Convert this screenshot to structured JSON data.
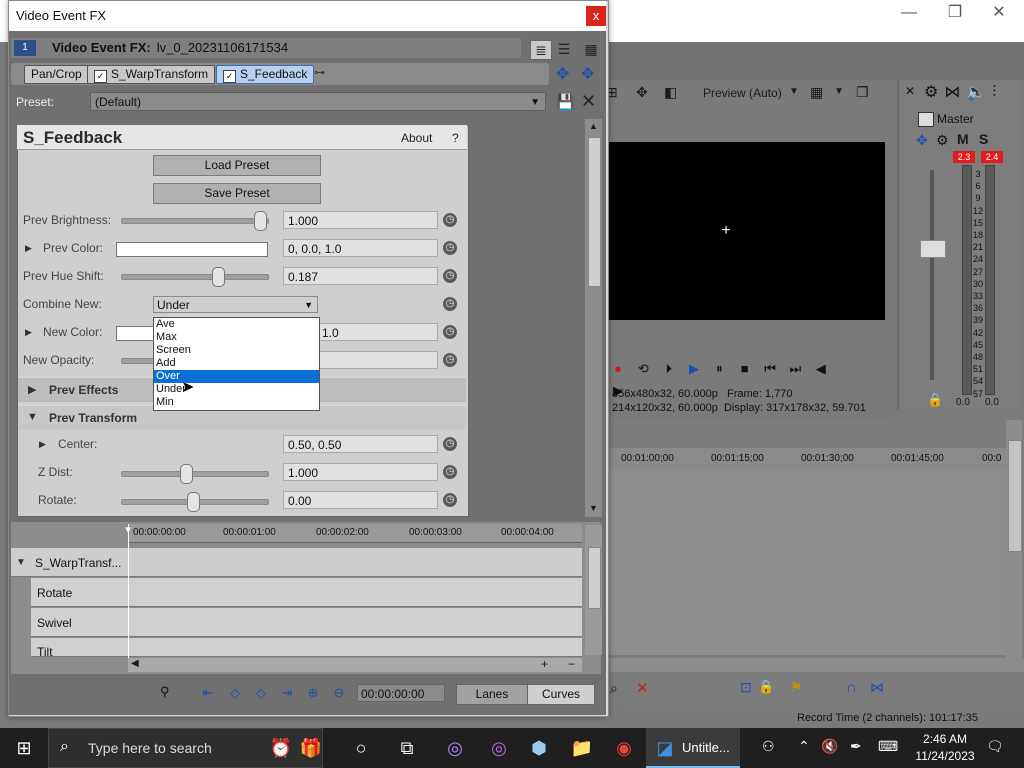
{
  "window": {
    "title": "Video Event FX",
    "close": "x"
  },
  "header": {
    "chain_index": "1",
    "event_label": "Video Event FX:",
    "event_name": "lv_0_20231106171534"
  },
  "fx_chain": [
    {
      "label": "Pan/Crop"
    },
    {
      "label": "S_WarpTransform"
    },
    {
      "label": "S_Feedback"
    }
  ],
  "preset": {
    "label": "Preset:",
    "value": "(Default)"
  },
  "plugin": {
    "name": "S_Feedback",
    "about": "About",
    "help": "?",
    "load_preset": "Load Preset",
    "save_preset": "Save Preset",
    "params": {
      "prev_brightness": {
        "label": "Prev Brightness:",
        "value": "1.000",
        "level": 1.0
      },
      "prev_color": {
        "label": "Prev Color:",
        "value": "0, 0.0, 1.0"
      },
      "prev_hue_shift": {
        "label": "Prev Hue Shift:",
        "value": "0.187",
        "level": 0.69
      },
      "combine_new": {
        "label": "Combine New:",
        "value": "Under"
      },
      "new_color": {
        "label": "New Color:",
        "value": "1.0"
      },
      "new_opacity": {
        "label": "New Opacity:"
      },
      "prev_effects": {
        "label": "Prev Effects"
      },
      "prev_transform": {
        "label": "Prev Transform"
      },
      "center": {
        "label": "Center:",
        "value": "0.50, 0.50"
      },
      "z_dist": {
        "label": "Z Dist:",
        "value": "1.000",
        "level": 0.45
      },
      "rotate": {
        "label": "Rotate:",
        "value": "0.00",
        "level": 0.5
      }
    },
    "combine_options": [
      "Ave",
      "Max",
      "Screen",
      "Add",
      "Over",
      "Under",
      "Min"
    ],
    "combine_highlight": "Over"
  },
  "keyframes": {
    "ruler": [
      "00:00:00:00",
      "00:00:01:00",
      "00:00:02:00",
      "00:00:03:00",
      "00:00:04:00"
    ],
    "track": "S_WarpTransf...",
    "lanes": [
      "Rotate",
      "Swivel",
      "Tilt"
    ],
    "time": "00:00:00:00",
    "lanes_btn": "Lanes",
    "curves_btn": "Curves"
  },
  "preview": {
    "quality": "Preview (Auto)",
    "info_line1_left": "856x480x32, 60.000p",
    "info_line1_right_label": "Frame:",
    "info_line1_right_value": "1,770",
    "info_line2_left": "214x120x32, 60.000p",
    "info_line2_right_label": "Display:",
    "info_line2_right_value": "317x178x32, 59.701"
  },
  "master": {
    "title": "Master",
    "m": "M",
    "s": "S",
    "peak_left": "2.3",
    "peak_right": "2.4",
    "scale": [
      "3",
      "6",
      "9",
      "12",
      "15",
      "18",
      "21",
      "24",
      "27",
      "30",
      "33",
      "36",
      "39",
      "42",
      "45",
      "48",
      "51",
      "54",
      "57"
    ],
    "level_left": "0.0",
    "level_right": "0.0"
  },
  "timeline": {
    "ticks": [
      "00:01:00;00",
      "00:01:15;00",
      "00:01:30;00",
      "00:01:45;00",
      "00:0"
    ]
  },
  "status": {
    "record_time": "Record Time (2 channels): 101:17:35"
  },
  "taskbar": {
    "search_placeholder": "Type here to search",
    "active_app": "Untitle...",
    "time": "2:46 AM",
    "date": "11/24/2023"
  }
}
